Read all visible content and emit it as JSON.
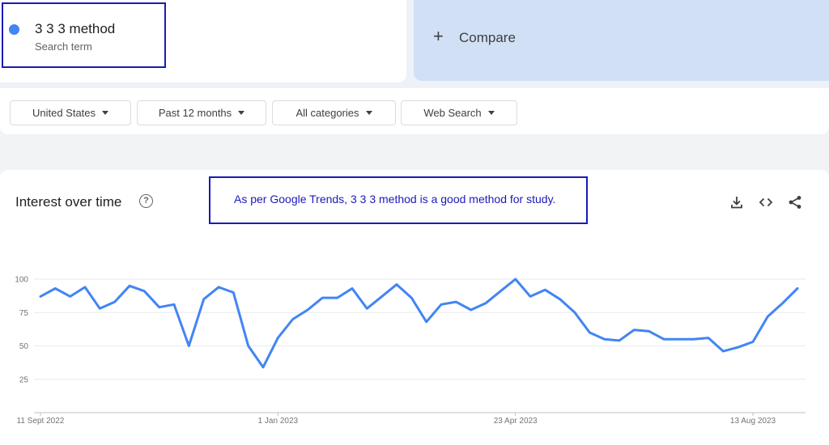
{
  "search_term": {
    "name": "3 3 3 method",
    "subtitle": "Search term",
    "color": "#4285f4"
  },
  "compare": {
    "plus": "+",
    "label": "Compare"
  },
  "filters": [
    {
      "label": "United States"
    },
    {
      "label": "Past 12 months"
    },
    {
      "label": "All categories"
    },
    {
      "label": "Web Search"
    }
  ],
  "chart_section": {
    "title": "Interest over time",
    "note": "As per Google Trends, 3 3 3 method is a good method for study.",
    "icons": [
      "help-icon",
      "download-icon",
      "embed-icon",
      "share-icon"
    ]
  },
  "chart_data": {
    "type": "line",
    "title": "",
    "x_labels": [
      "11 Sept 2022",
      "1 Jan 2023",
      "23 Apr 2023",
      "13 Aug 2023"
    ],
    "x_label_indices": [
      0,
      16,
      32,
      48
    ],
    "y_ticks": [
      25,
      50,
      75,
      100
    ],
    "ylim": [
      0,
      100
    ],
    "grid": true,
    "series": [
      {
        "color": "#4285f4",
        "values": [
          87,
          93,
          87,
          94,
          78,
          83,
          95,
          91,
          79,
          81,
          50,
          85,
          94,
          90,
          50,
          34,
          56,
          70,
          77,
          86,
          86,
          93,
          78,
          87,
          96,
          86,
          68,
          81,
          83,
          77,
          82,
          91,
          100,
          87,
          92,
          85,
          75,
          60,
          55,
          54,
          62,
          61,
          55,
          55,
          55,
          56,
          46,
          49,
          53,
          72,
          82,
          93
        ]
      }
    ]
  }
}
